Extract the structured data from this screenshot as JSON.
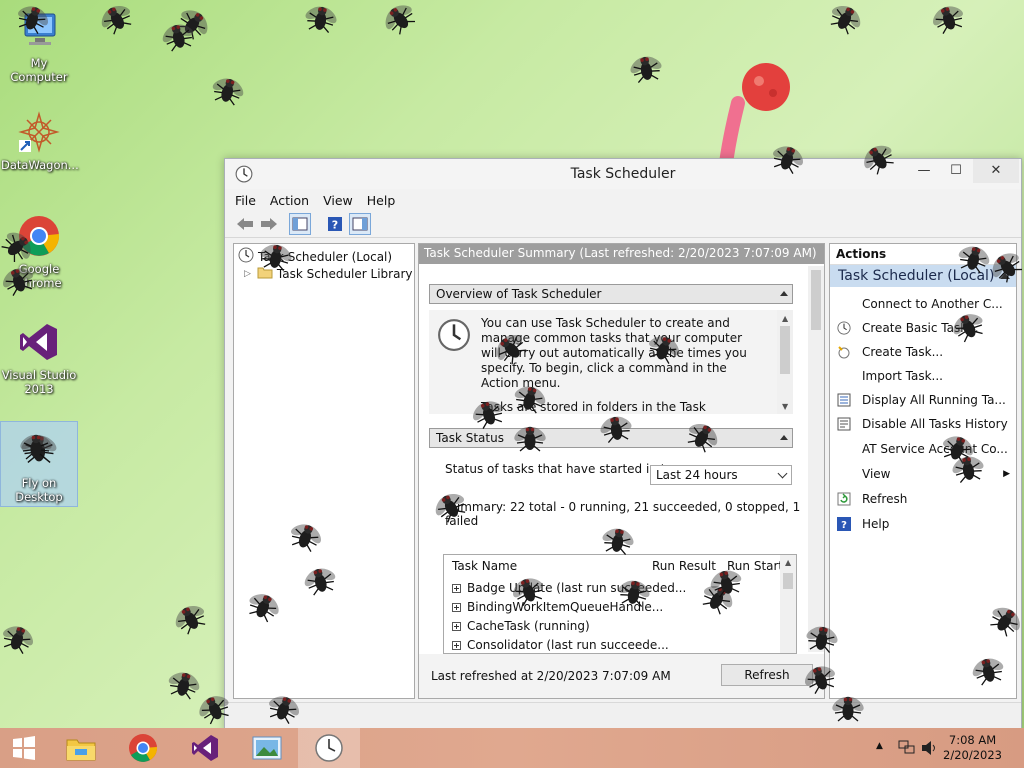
{
  "desktop": {
    "icons": [
      {
        "label": "My Computer"
      },
      {
        "label": "DataWagon..."
      },
      {
        "label": "Google Chrome"
      },
      {
        "label": "Visual Studio 2013"
      },
      {
        "label": "Fly on Desktop"
      }
    ]
  },
  "window": {
    "title": "Task Scheduler",
    "buttons": {
      "minimize": "—",
      "maximize": "☐",
      "close": "✕"
    },
    "menu": [
      "File",
      "Action",
      "View",
      "Help"
    ],
    "tree": {
      "root": "Task Scheduler (Local)",
      "child": "Task Scheduler Library"
    },
    "center": {
      "header": "Task Scheduler Summary (Last refreshed: 2/20/2023 7:07:09 AM)",
      "overview": {
        "title": "Overview of Task Scheduler",
        "paragraphs": [
          "You can use Task Scheduler to create and manage common tasks that your computer will carry out automatically at the times you specify. To begin, click a command in the Action menu.",
          "Tasks are stored in folders in the Task Scheduler Library. To view or perform an operation on an"
        ]
      },
      "task_status": {
        "title": "Task Status",
        "filter_label": "Status of tasks that have started in t...",
        "filter_value": "Last 24 hours",
        "summary": "Summary: 22 total - 0 running, 21 succeeded, 0 stopped, 1 failed",
        "columns": [
          "Task Name",
          "Run Result",
          "Run Start"
        ],
        "rows": [
          "Badge Update (last run succeeded...",
          "BindingWorkItemQueueHandle...",
          "CacheTask (running)",
          "Consolidator (last run succeede..."
        ]
      },
      "last_refreshed": "Last refreshed at 2/20/2023 7:07:09 AM",
      "refresh_button": "Refresh"
    },
    "actions": {
      "header": "Actions",
      "section": "Task Scheduler (Local)",
      "items": [
        {
          "label": "Connect to Another C...",
          "icon": "none"
        },
        {
          "label": "Create Basic Task...",
          "icon": "clock-wizard-icon"
        },
        {
          "label": "Create Task...",
          "icon": "new-task-icon"
        },
        {
          "label": "Import Task...",
          "icon": "none"
        },
        {
          "label": "Display All Running Ta...",
          "icon": "running-tasks-icon"
        },
        {
          "label": "Disable All Tasks History",
          "icon": "history-icon"
        },
        {
          "label": "AT Service Account Co...",
          "icon": "none"
        },
        {
          "label": "View",
          "icon": "none"
        },
        {
          "label": "Refresh",
          "icon": "refresh-icon"
        },
        {
          "label": "Help",
          "icon": "help-icon"
        }
      ]
    }
  },
  "taskbar": {
    "time": "7:08 AM",
    "date": "2/20/2023"
  },
  "colors": {
    "actions_section_bg": "#c9dcf0",
    "center_header_bg": "#9e9e9e",
    "taskbar_bg": "#dca189"
  }
}
